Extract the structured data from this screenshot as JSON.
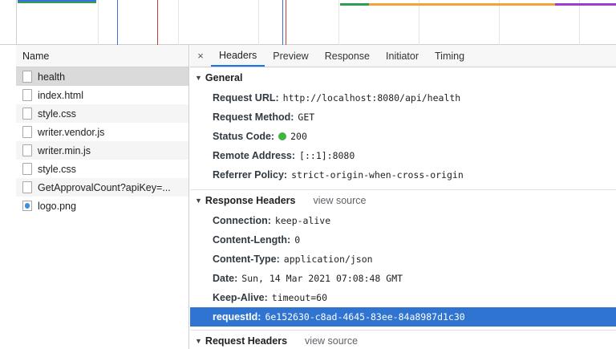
{
  "requests_panel": {
    "column_header": "Name",
    "items": [
      {
        "name": "health",
        "icon": "file-icon",
        "selected": true
      },
      {
        "name": "index.html",
        "icon": "file-icon"
      },
      {
        "name": "style.css",
        "icon": "file-icon"
      },
      {
        "name": "writer.vendor.js",
        "icon": "file-icon"
      },
      {
        "name": "writer.min.js",
        "icon": "file-icon"
      },
      {
        "name": "style.css",
        "icon": "file-icon"
      },
      {
        "name": "GetApprovalCount?apiKey=...",
        "icon": "file-icon"
      },
      {
        "name": "logo.png",
        "icon": "image-icon"
      }
    ]
  },
  "details_panel": {
    "close_icon": "×",
    "tabs": [
      "Headers",
      "Preview",
      "Response",
      "Initiator",
      "Timing"
    ],
    "active_tab": "Headers",
    "general": {
      "title": "General",
      "rows": [
        {
          "key": "Request URL:",
          "value": "http://localhost:8080/api/health"
        },
        {
          "key": "Request Method:",
          "value": "GET"
        },
        {
          "key": "Status Code:",
          "value": "200",
          "status_color": "#3fb53f"
        },
        {
          "key": "Remote Address:",
          "value": "[::1]:8080"
        },
        {
          "key": "Referrer Policy:",
          "value": "strict-origin-when-cross-origin"
        }
      ]
    },
    "response_headers": {
      "title": "Response Headers",
      "view_source": "view source",
      "rows": [
        {
          "key": "Connection:",
          "value": "keep-alive"
        },
        {
          "key": "Content-Length:",
          "value": "0"
        },
        {
          "key": "Content-Type:",
          "value": "application/json"
        },
        {
          "key": "Date:",
          "value": "Sun, 14 Mar 2021 07:08:48 GMT"
        },
        {
          "key": "Keep-Alive:",
          "value": "timeout=60"
        },
        {
          "key": "requestId:",
          "value": "6e152630-c8ad-4645-83ee-84a8987d1c30",
          "selected": true
        }
      ]
    },
    "request_headers": {
      "title": "Request Headers",
      "view_source": "view source"
    }
  },
  "colors": {
    "accent": "#1a73e8",
    "selection": "#2f74d0",
    "status_ok": "#3fb53f",
    "waterfall_green": "#2e9e54",
    "waterfall_orange": "#f2a33a",
    "waterfall_purple": "#9b3fd1",
    "waterfall_blue": "#3d6fd8",
    "waterfall_red": "#c23b3b"
  }
}
